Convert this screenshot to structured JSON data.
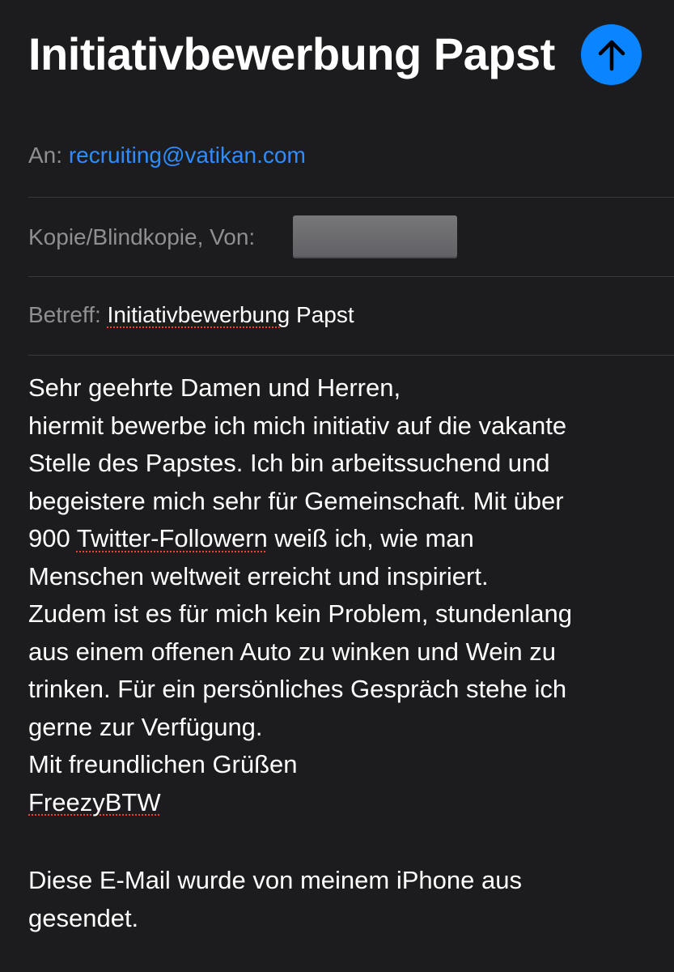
{
  "header": {
    "subject_title": "Initiativbewerbung Papst",
    "send_icon": "arrow-up-icon",
    "send_button_color": "#0a84ff"
  },
  "fields": {
    "to_label": "An:",
    "to_value": "recruiting@vatikan.com",
    "cc_label": "Kopie/Blindkopie, Von:",
    "subject_label": "Betreff:",
    "subject_value_misspelled": "Initiativbewerbung",
    "subject_value_rest": " Papst"
  },
  "body": {
    "line1": "Sehr geehrte Damen und Herren,",
    "line2": "hiermit bewerbe ich mich initiativ auf die vakante",
    "line3": "Stelle des Papstes. Ich bin arbeitssuchend und",
    "line4": "begeistere mich sehr für Gemeinschaft. Mit über",
    "line5_pre": "900 ",
    "line5_misspelled": "Twitter-Followern",
    "line5_post": " weiß ich, wie man",
    "line6": "Menschen weltweit erreicht und inspiriert.",
    "line7": "Zudem ist es für mich kein Problem, stundenlang",
    "line8": "aus einem offenen Auto zu winken und Wein zu",
    "line9": "trinken. Für ein persönliches Gespräch stehe ich",
    "line10": "gerne zur Verfügung.",
    "closing": "Mit freundlichen Grüßen",
    "signature_name": "FreezyBTW"
  },
  "signature": {
    "line1": "Diese E-Mail wurde von meinem iPhone aus",
    "line2": "gesendet."
  },
  "colors": {
    "background": "#1c1c1e",
    "label": "#8e8e93",
    "link": "#2f8cff",
    "spellcheck": "#ff3b30"
  }
}
